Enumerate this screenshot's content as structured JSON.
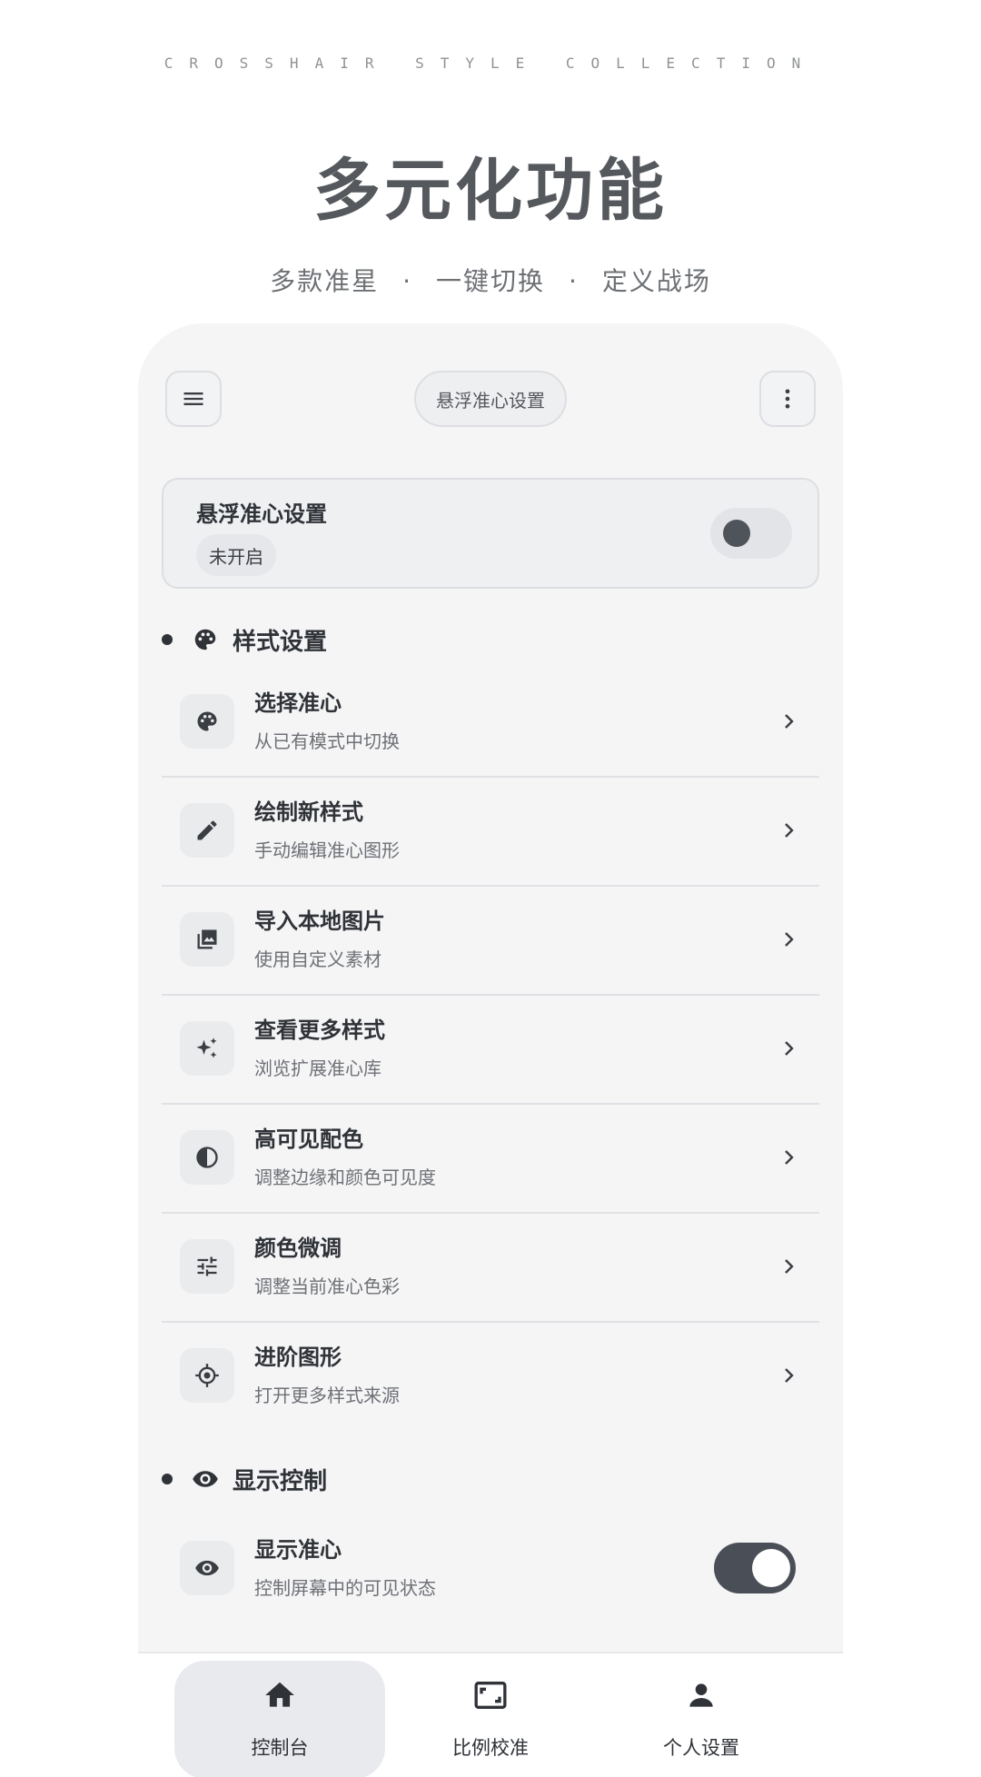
{
  "header": {
    "eyebrow": "CROSSHAIR STYLE COLLECTION",
    "title": "多元化功能",
    "subtitle_parts": [
      "多款准星",
      "一键切换",
      "定义战场"
    ],
    "separator": "·"
  },
  "app_bar": {
    "menu_icon": "menu-icon",
    "title": "悬浮准心设置",
    "more_icon": "more-vert-icon"
  },
  "float_card": {
    "title": "悬浮准心设置",
    "status": "未开启",
    "toggle_on": false
  },
  "style_section": {
    "icon": "palette-icon",
    "label": "样式设置",
    "items": [
      {
        "icon": "palette-icon",
        "title": "选择准心",
        "subtitle": "从已有模式中切换"
      },
      {
        "icon": "pencil-icon",
        "title": "绘制新样式",
        "subtitle": "手动编辑准心图形"
      },
      {
        "icon": "image-icon",
        "title": "导入本地图片",
        "subtitle": "使用自定义素材"
      },
      {
        "icon": "sparkle-icon",
        "title": "查看更多样式",
        "subtitle": "浏览扩展准心库"
      },
      {
        "icon": "contrast-icon",
        "title": "高可见配色",
        "subtitle": "调整边缘和颜色可见度"
      },
      {
        "icon": "tune-icon",
        "title": "颜色微调",
        "subtitle": "调整当前准心色彩"
      },
      {
        "icon": "crosshair-icon",
        "title": "进阶图形",
        "subtitle": "打开更多样式来源"
      }
    ]
  },
  "display_section": {
    "icon": "eye-icon",
    "label": "显示控制",
    "item": {
      "icon": "eye-icon",
      "title": "显示准心",
      "subtitle": "控制屏幕中的可见状态",
      "toggle_on": true
    }
  },
  "bottom_nav": {
    "items": [
      {
        "icon": "home-icon",
        "label": "控制台",
        "active": true
      },
      {
        "icon": "aspect-ratio-icon",
        "label": "比例校准",
        "active": false
      },
      {
        "icon": "person-icon",
        "label": "个人设置",
        "active": false
      }
    ]
  }
}
